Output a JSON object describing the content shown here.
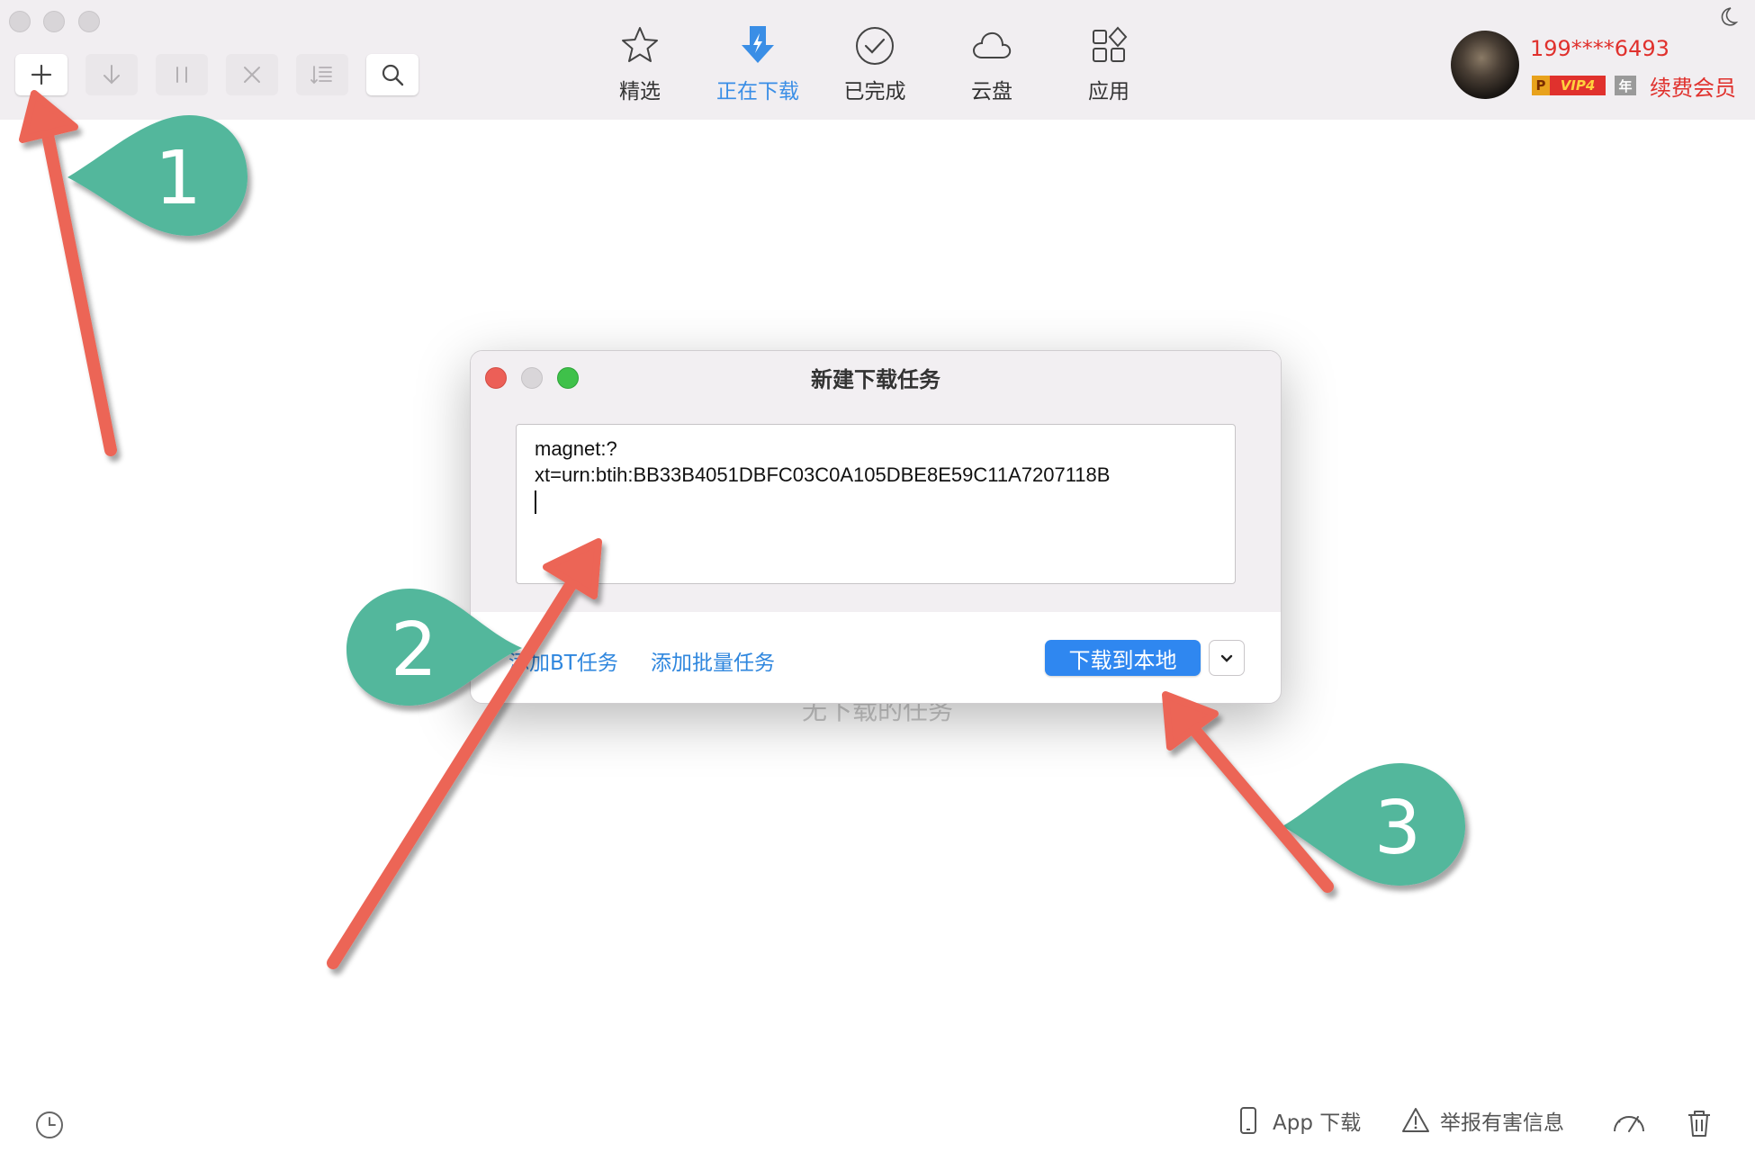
{
  "toolbar": {
    "buttons": [
      {
        "name": "new-task",
        "icon": "plus-icon"
      },
      {
        "name": "start",
        "icon": "download-arrow-icon"
      },
      {
        "name": "pause",
        "icon": "pause-icon"
      },
      {
        "name": "delete",
        "icon": "close-icon"
      },
      {
        "name": "sort",
        "icon": "sort-list-icon"
      },
      {
        "name": "search",
        "icon": "search-icon"
      }
    ]
  },
  "nav": {
    "tabs": [
      {
        "label": "精选",
        "icon": "star-icon",
        "active": false
      },
      {
        "label": "正在下载",
        "icon": "download-bolt-icon",
        "active": true
      },
      {
        "label": "已完成",
        "icon": "check-circle-icon",
        "active": false
      },
      {
        "label": "云盘",
        "icon": "cloud-icon",
        "active": false
      },
      {
        "label": "应用",
        "icon": "apps-grid-icon",
        "active": false
      }
    ]
  },
  "user": {
    "phone": "199****6493",
    "badge_p": "P",
    "badge_vip": "VIP4",
    "badge_year": "年",
    "renew_label": "续费会员"
  },
  "main": {
    "empty_text": "无下载的任务"
  },
  "dialog": {
    "title": "新建下载任务",
    "magnet_line1": "magnet:?",
    "magnet_line2": "xt=urn:btih:BB33B4051DBFC03C0A105DBE8E59C11A7207118B",
    "add_bt_label": "添加BT任务",
    "add_batch_label": "添加批量任务",
    "download_local_label": "下载到本地"
  },
  "bottom": {
    "app_download_label": "App 下载",
    "report_label": "举报有害信息"
  },
  "annotations": {
    "markers": [
      "1",
      "2",
      "3"
    ]
  },
  "colors": {
    "accent": "#2f87f0",
    "vip_red": "#e0312d",
    "arrow": "#ec6557",
    "marker": "#52b79c",
    "toolbar_bg": "#f1eef1"
  }
}
